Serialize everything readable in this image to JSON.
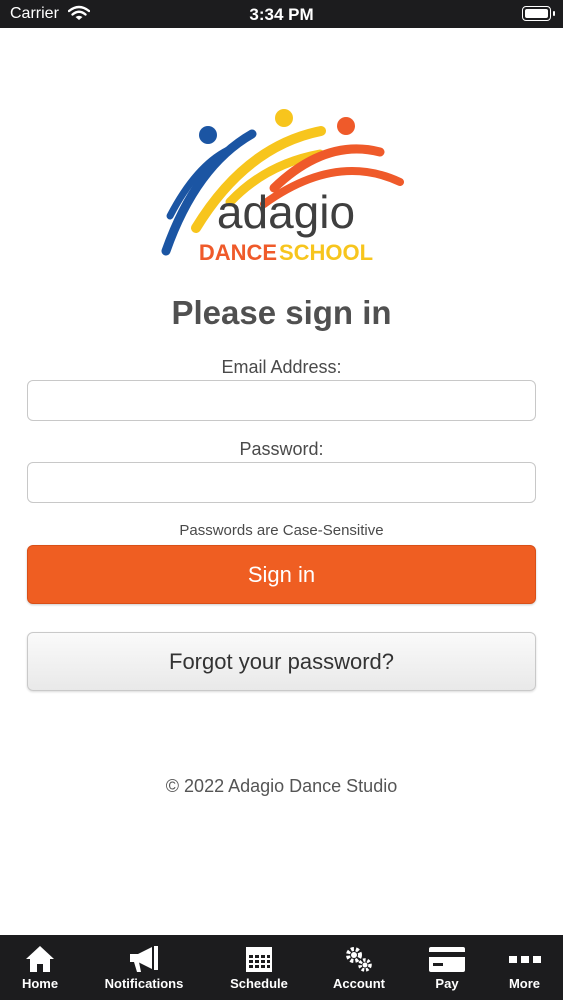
{
  "status_bar": {
    "carrier": "Carrier",
    "time": "3:34 PM"
  },
  "logo": {
    "name": "adagio",
    "subtitle_left": "DANCE",
    "subtitle_right": "SCHOOL"
  },
  "sign_in": {
    "heading": "Please sign in",
    "email_label": "Email Address:",
    "email_value": "",
    "password_label": "Password:",
    "password_value": "",
    "case_note": "Passwords are Case-Sensitive",
    "sign_in_button": "Sign in",
    "forgot_button": "Forgot your password?"
  },
  "footer": {
    "copyright": "© 2022 Adagio Dance Studio"
  },
  "tab_bar": {
    "items": [
      {
        "label": "Home",
        "icon": "home-icon"
      },
      {
        "label": "Notifications",
        "icon": "megaphone-icon"
      },
      {
        "label": "Schedule",
        "icon": "calendar-icon"
      },
      {
        "label": "Account",
        "icon": "gears-icon"
      },
      {
        "label": "Pay",
        "icon": "credit-card-icon"
      },
      {
        "label": "More",
        "icon": "more-icon"
      }
    ]
  },
  "colors": {
    "accent": "#ef5e22",
    "logo_blue": "#1b55a3",
    "logo_yellow": "#f7c51d",
    "logo_orange": "#ef5a2a",
    "bar_background": "#1c1c1e"
  }
}
